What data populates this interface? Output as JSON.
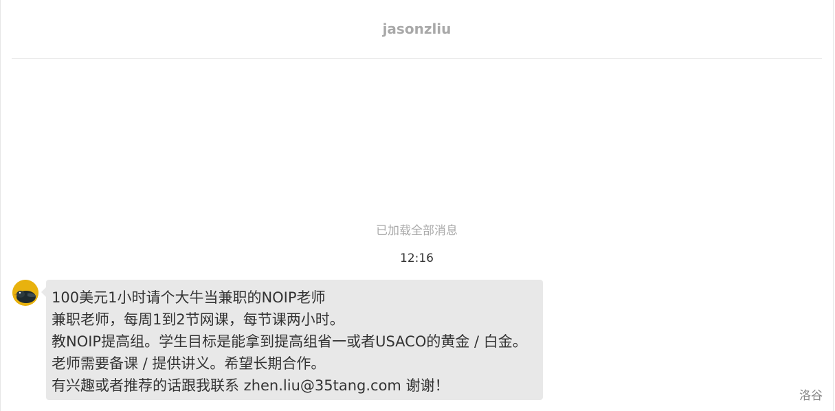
{
  "header": {
    "title": "jasonzliu"
  },
  "history": {
    "loaded_note": "已加载全部消息"
  },
  "messages": [
    {
      "time": "12:16",
      "lines": [
        "100美元1小时请个大牛当兼职的NOIP老师",
        "兼职老师，每周1到2节网课，每节课两小时。",
        "教NOIP提高组。学生目标是能拿到提高组省一或者USACO的黄金 / 白金。",
        "老师需要备课 / 提供讲义。希望长期合作。",
        "有兴趣或者推荐的话跟我联系 zhen.liu@35tang.com 谢谢！"
      ]
    }
  ],
  "footer": {
    "brand": "洛谷"
  },
  "colors": {
    "bubble_bg": "#e8e8e8",
    "avatar_bg": "#e8b20e",
    "muted_text": "#aaaaaa",
    "body_text": "#333333"
  }
}
